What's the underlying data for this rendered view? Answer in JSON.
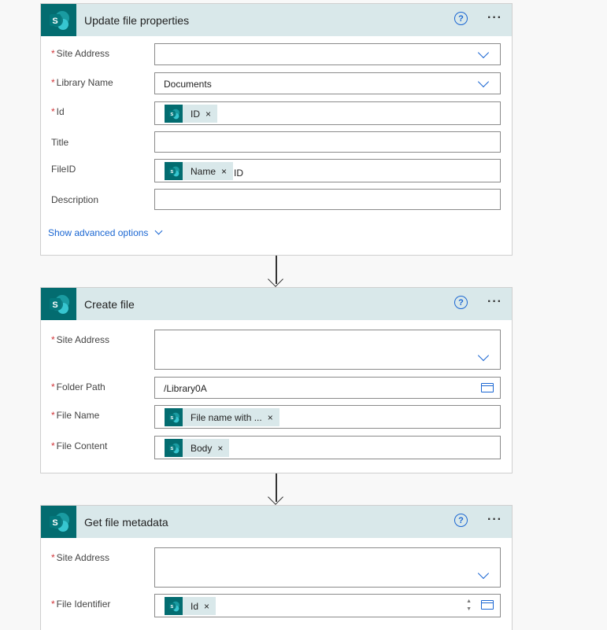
{
  "required_mark": "*",
  "step1": {
    "title": "Update file properties",
    "help": "?",
    "more": "···",
    "fields": {
      "site_address": "Site Address",
      "library_name": "Library Name",
      "library_value": "Documents",
      "id": "Id",
      "id_token": "ID",
      "title": "Title",
      "file_id": "FileID",
      "file_id_token": "Name",
      "file_id_suffix": "ID",
      "description": "Description"
    },
    "advanced": "Show advanced options"
  },
  "step2": {
    "title": "Create file",
    "help": "?",
    "more": "···",
    "fields": {
      "site_address": "Site Address",
      "folder_path": "Folder Path",
      "folder_value": "/Library0A",
      "file_name": "File Name",
      "file_name_token": "File name with ...",
      "file_content": "File Content",
      "file_content_token": "Body"
    }
  },
  "step3": {
    "title": "Get file metadata",
    "help": "?",
    "more": "···",
    "fields": {
      "site_address": "Site Address",
      "file_identifier": "File Identifier",
      "file_identifier_token": "Id"
    }
  },
  "token_x": "×",
  "stepper_up": "▲",
  "stepper_down": "▼",
  "colors": {
    "sharepoint": "#036c70",
    "header_bg": "#d9e8ea",
    "link": "#1a66d2",
    "required": "#d13438"
  }
}
